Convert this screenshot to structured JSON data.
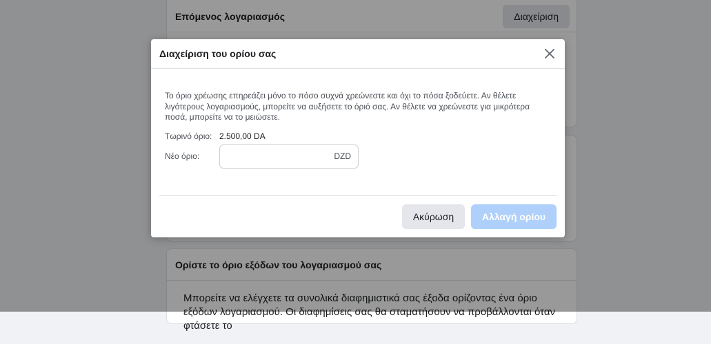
{
  "background": {
    "card1": {
      "title": "Επόμενος λογαριασμός",
      "manage_label": "Διαχείριση"
    },
    "card3": {
      "title": "Ορίστε το όριο εξόδων του λογαριασμού σας",
      "body": "Μπορείτε να ελέγχετε τα συνολικά διαφημιστικά σας έξοδα ορίζοντας ένα όριο εξόδων λογαριασμού. Οι διαφημίσεις σας θα σταματήσουν να προβάλλονται όταν φτάσετε το"
    }
  },
  "modal": {
    "title": "Διαχείριση του ορίου σας",
    "description": "Το όριο χρέωσης επηρεάζει μόνο το πόσο συχνά χρεώνεστε και όχι το πόσα ξοδεύετε. Αν θέλετε λιγότερους λογαριασμούς, μπορείτε να αυξήσετε το όριό σας. Αν θέλετε να χρεώνεστε για μικρότερα ποσά, μπορείτε να το μειώσετε.",
    "current_limit_label": "Τωρινό όριο:",
    "current_limit_value": "2.500,00 DA",
    "new_limit_label": "Νέο όριο:",
    "new_limit_value": "",
    "new_limit_placeholder": "",
    "currency": "DZD",
    "cancel_label": "Ακύρωση",
    "submit_label": "Αλλαγή ορίου"
  },
  "colors": {
    "overlay": "rgba(0,0,0,0.4)",
    "primary_disabled": "#aed0fa",
    "secondary_button": "#e4e6eb"
  },
  "icons": {
    "close": "close-icon"
  }
}
